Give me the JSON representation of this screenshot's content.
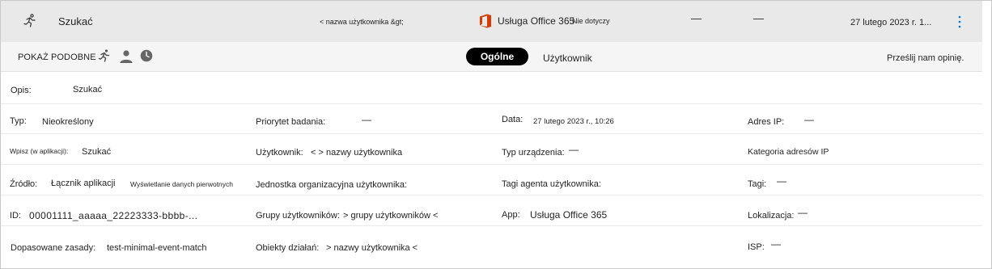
{
  "top_row": {
    "title": "Szukać",
    "user": "< nazwa użytkownika &gt;",
    "app_name": "Usługa Office 365",
    "app_note": "Nie dotyczy",
    "dash1": "—",
    "dash2": "—",
    "date": "27 lutego 2023 r. 1...",
    "icons": {
      "activity": "running-person-icon",
      "app": "office-logo-icon",
      "menu": "more-vertical-icon"
    }
  },
  "toolbar": {
    "show_similar": "POKAŻ PODOBNE",
    "icons": [
      "running-person-icon",
      "person-icon",
      "clock-icon"
    ],
    "tabs": [
      {
        "label": "Ogólne",
        "selected": true
      },
      {
        "label": "Użytkownik",
        "selected": false
      }
    ],
    "feedback": "Prześlij nam opinię."
  },
  "details": {
    "description": {
      "label": "Opis:",
      "value": "Szukać"
    },
    "col1": {
      "type_label": "Typ:",
      "type_value": "Nieokreślony",
      "enter_label": "Wpisz (w aplikacji):",
      "enter_value": "Szukać",
      "source_label": "Źródło:",
      "source_value1": "Łącznik aplikacji",
      "source_value2": "Wyświetlanie danych pierwotnych",
      "id_label": "ID:",
      "id_value": "00001111_aaaaa_22223333-bbbb-...",
      "policies_label": "Dopasowane zasady:",
      "policies_value": "test-minimal-event-match"
    },
    "col2": {
      "priority_label": "Priorytet badania:",
      "priority_value": "—",
      "user_label": "Użytkownik:",
      "user_value": "< > nazwy użytkownika",
      "org_unit_label": "Jednostka organizacyjna użytkownika:",
      "groups_label": "Grupy użytkowników:",
      "groups_value": "> grupy użytkowników <",
      "objects_label": "Obiekty działań:",
      "objects_value": "> nazwy użytkownika <"
    },
    "col3": {
      "date_label": "Data:",
      "date_value": "27 lutego 2023 r., 10:26",
      "device_label": "Typ urządzenia:",
      "device_value": "—",
      "agent_tags_label": "Tagi agenta użytkownika:",
      "app_label": "App:",
      "app_value": "Usługa Office 365"
    },
    "col4": {
      "ip_label": "Adres IP:",
      "ip_value": "—",
      "ip_category_label": "Kategoria adresów IP",
      "tags_label": "Tagi:",
      "tags_value": "—",
      "location_label": "Lokalizacja:",
      "location_value": "—",
      "isp_label": "ISP:",
      "isp_value": "—"
    }
  }
}
